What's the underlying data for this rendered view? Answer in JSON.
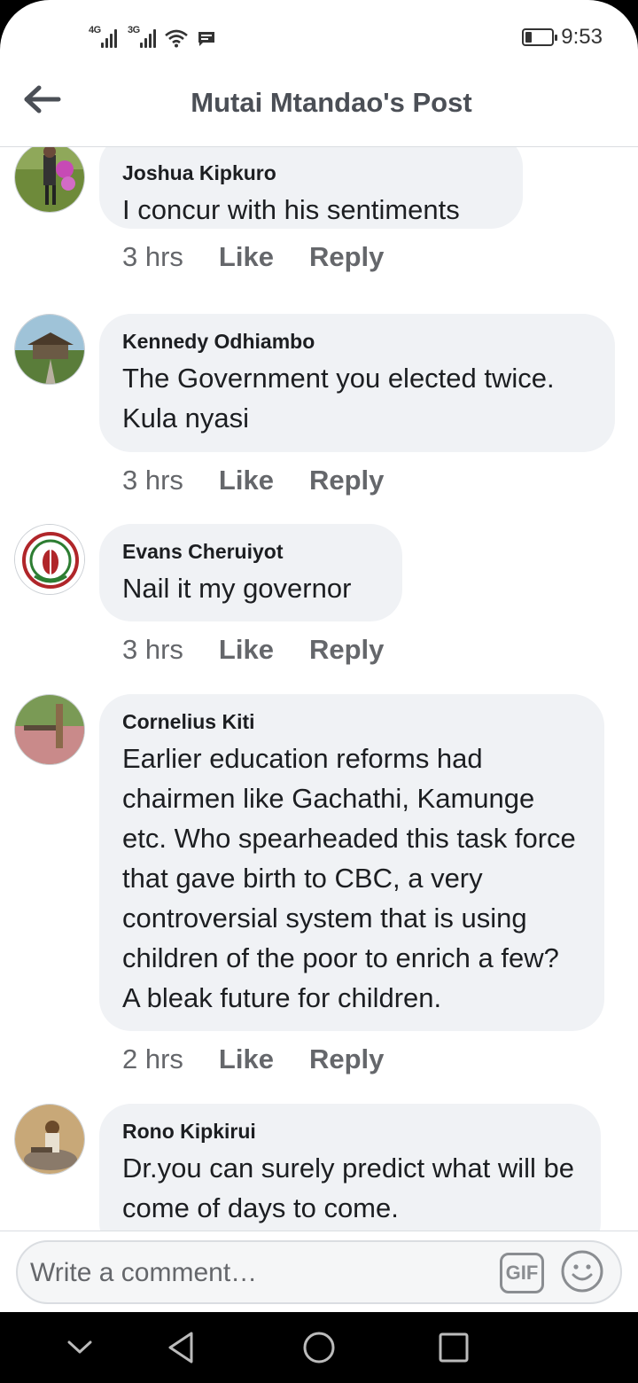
{
  "status_bar": {
    "sim1": "4G",
    "sim2": "3G",
    "time": "9:53",
    "battery_fraction": 0.25
  },
  "header": {
    "title": "Mutai Mtandao's Post"
  },
  "comments": [
    {
      "author": "Joshua Kipkuro",
      "text": "I concur with his sentiments",
      "time": "3 hrs",
      "like": "Like",
      "reply": "Reply"
    },
    {
      "author": "Kennedy Odhiambo",
      "text": "The Government you elected twice. Kula nyasi",
      "time": "3 hrs",
      "like": "Like",
      "reply": "Reply"
    },
    {
      "author": "Evans Cheruiyot",
      "text": "Nail it my governor",
      "time": "3 hrs",
      "like": "Like",
      "reply": "Reply"
    },
    {
      "author": "Cornelius Kiti",
      "text": "Earlier education reforms had chairmen like Gachathi, Kamunge etc. Who spearheaded this task force that gave birth to CBC, a very controversial system that is using children of the poor to enrich a few? A bleak future for children.",
      "time": "2 hrs",
      "like": "Like",
      "reply": "Reply"
    },
    {
      "author": "Rono Kipkirui",
      "text": "Dr.you can surely predict what will be come of days to come.",
      "time": "",
      "like": "",
      "reply": ""
    }
  ],
  "composer": {
    "placeholder": "Write a comment…",
    "gif_label": "GIF"
  },
  "icons": {
    "back": "arrow-left-icon",
    "gif": "gif-icon",
    "emoji": "smiley-icon",
    "nav_back": "triangle-back-icon",
    "nav_home": "circle-home-icon",
    "nav_recents": "square-recents-icon",
    "nav_hide": "chevron-down-icon"
  },
  "colors": {
    "bubble": "#f0f2f5",
    "meta_text": "#65676b",
    "header_text": "#4b4f56"
  }
}
